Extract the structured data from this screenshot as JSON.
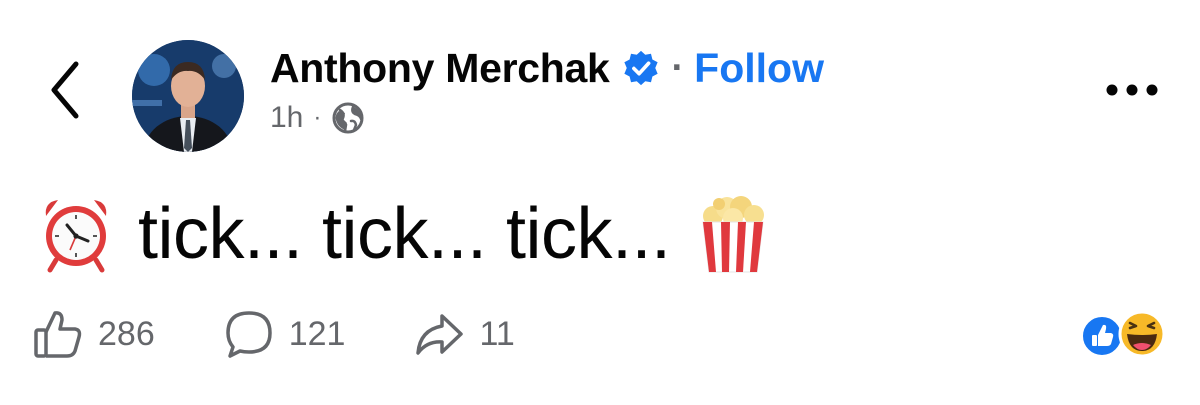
{
  "nav": {
    "back_icon": "chevron-left-icon",
    "more_icon": "ellipsis-icon"
  },
  "author": {
    "name": "Anthony Merchak",
    "verified_icon": "verified-badge-icon",
    "separator": "·",
    "follow_label": "Follow",
    "avatar_icon": "profile-photo"
  },
  "meta": {
    "time": "1h",
    "separator": "·",
    "audience_icon": "globe-icon"
  },
  "post": {
    "leading_emoji": "alarm-clock-emoji",
    "text": "tick... tick... tick...",
    "trailing_emoji": "popcorn-emoji"
  },
  "actions": {
    "likes": "286",
    "comments": "121",
    "shares": "11"
  },
  "reactions": [
    "like-reaction-icon",
    "haha-reaction-icon"
  ],
  "colors": {
    "accent": "#1877f2",
    "text": "#050505",
    "secondary": "#65676b"
  }
}
